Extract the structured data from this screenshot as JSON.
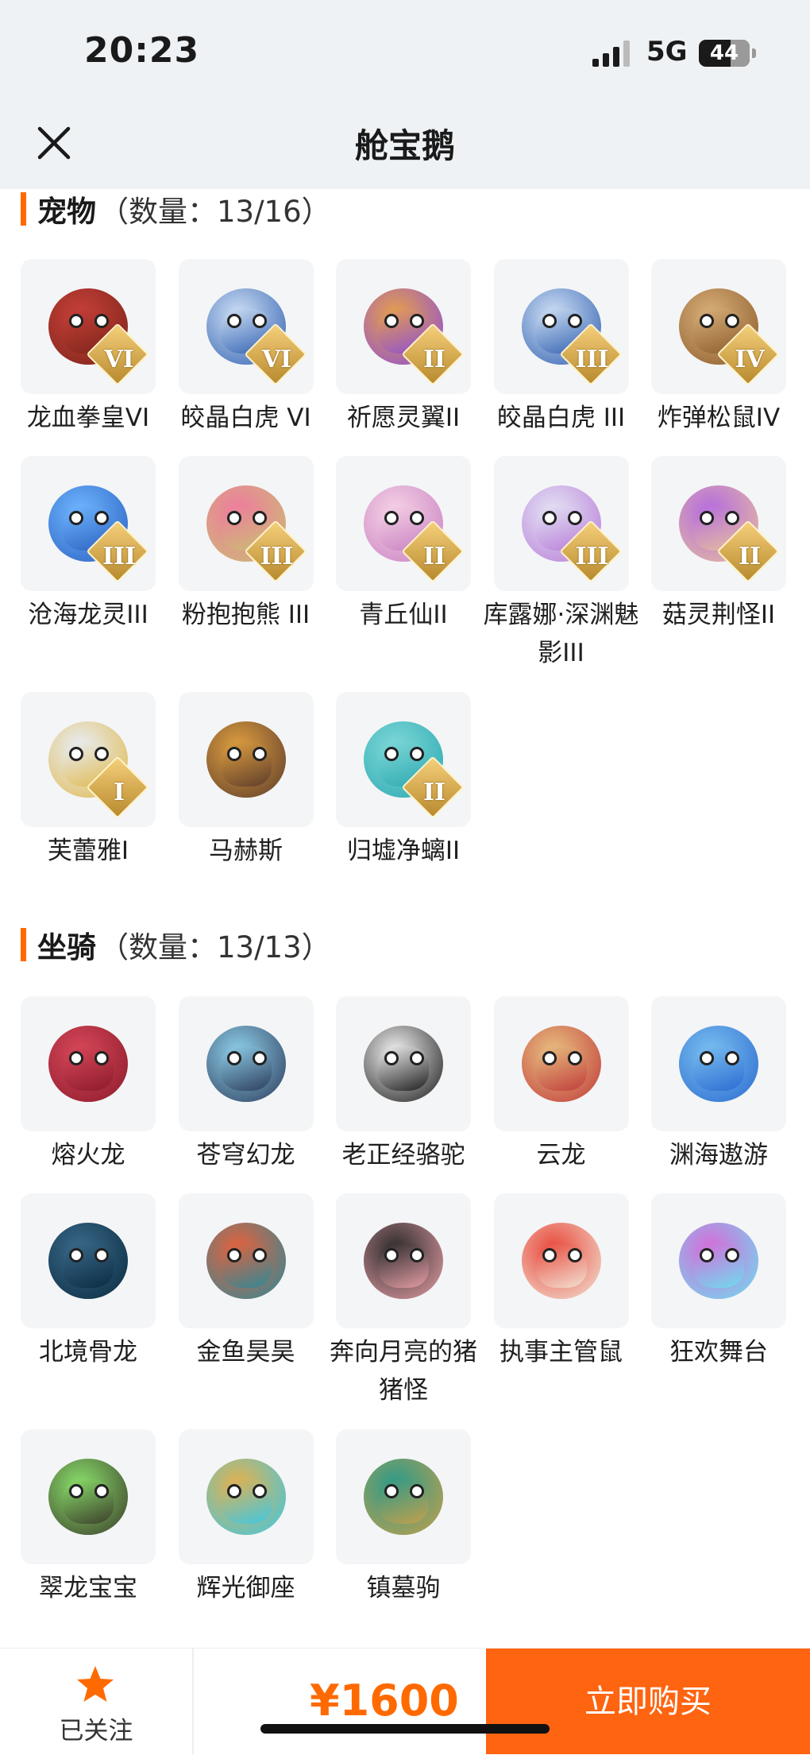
{
  "status_bar": {
    "time": "20:23",
    "network": "5G",
    "battery": "44"
  },
  "nav": {
    "title": "舱宝鹅"
  },
  "pets": {
    "title": "宠物",
    "count": "（数量：13/16）",
    "items": [
      {
        "name": "龙血拳皇VI",
        "badge": "VI",
        "c1": "#c8403a",
        "c2": "#7a2418"
      },
      {
        "name": "皎晶白虎 VI",
        "badge": "VI",
        "c1": "#cfe0f5",
        "c2": "#2f5fb0"
      },
      {
        "name": "祈愿灵翼II",
        "badge": "II",
        "c1": "#e8a04a",
        "c2": "#8a4cd8"
      },
      {
        "name": "皎晶白虎 III",
        "badge": "III",
        "c1": "#cfe0f5",
        "c2": "#2f5fb0"
      },
      {
        "name": "炸弹松鼠IV",
        "badge": "IV",
        "c1": "#d9b07a",
        "c2": "#8a5a2a"
      },
      {
        "name": "沧海龙灵III",
        "badge": "III",
        "c1": "#6fb7ff",
        "c2": "#2a5fc0"
      },
      {
        "name": "粉抱抱熊 III",
        "badge": "III",
        "c1": "#f07aa0",
        "c2": "#c8c070"
      },
      {
        "name": "青丘仙II",
        "badge": "II",
        "c1": "#f6d3e6",
        "c2": "#c77fc1"
      },
      {
        "name": "库露娜·深渊魅影III",
        "badge": "III",
        "c1": "#e4e4f4",
        "c2": "#b77ad8"
      },
      {
        "name": "菇灵荆怪II",
        "badge": "II",
        "c1": "#b46ae0",
        "c2": "#e8c29a"
      },
      {
        "name": "芙蕾雅I",
        "badge": "I",
        "c1": "#e8eef8",
        "c2": "#e0b84a"
      },
      {
        "name": "马赫斯",
        "badge": "",
        "c1": "#e0a040",
        "c2": "#5a3a2a"
      },
      {
        "name": "归墟净螭II",
        "badge": "II",
        "c1": "#7fd8d8",
        "c2": "#2aa8b0"
      }
    ]
  },
  "mounts": {
    "title": "坐骑",
    "count": "（数量：13/13）",
    "items": [
      {
        "name": "熔火龙",
        "c1": "#d8485a",
        "c2": "#8a1a2a"
      },
      {
        "name": "苍穹幻龙",
        "c1": "#8fd0ea",
        "c2": "#2a3a5a"
      },
      {
        "name": "老正经骆驼",
        "c1": "#f2f2f2",
        "c2": "#1a1a1a"
      },
      {
        "name": "云龙",
        "c1": "#e8c080",
        "c2": "#c03a3a"
      },
      {
        "name": "渊海遨游",
        "c1": "#7ac0f0",
        "c2": "#2a6ad0"
      },
      {
        "name": "北境骨龙",
        "c1": "#3a6a8a",
        "c2": "#0a2a40"
      },
      {
        "name": "金鱼昊昊",
        "c1": "#e8603a",
        "c2": "#2a8a9a"
      },
      {
        "name": "奔向月亮的猪猪怪",
        "c1": "#2a2a2a",
        "c2": "#e8a0a8"
      },
      {
        "name": "执事主管鼠",
        "c1": "#e8483a",
        "c2": "#f2e6d8"
      },
      {
        "name": "狂欢舞台",
        "c1": "#d86ad8",
        "c2": "#6ae0f0"
      },
      {
        "name": "翠龙宝宝",
        "c1": "#8ae06a",
        "c2": "#3a3a2a"
      },
      {
        "name": "辉光御座",
        "c1": "#e8b04a",
        "c2": "#3ac8e8"
      },
      {
        "name": "镇墓驹",
        "c1": "#2a9a8a",
        "c2": "#c8a04a"
      }
    ]
  },
  "bottom": {
    "follow_label": "已关注",
    "price": "¥1600",
    "buy_label": "立即购买"
  },
  "colors": {
    "accent": "#ff6a00",
    "buy": "#ff6410"
  }
}
